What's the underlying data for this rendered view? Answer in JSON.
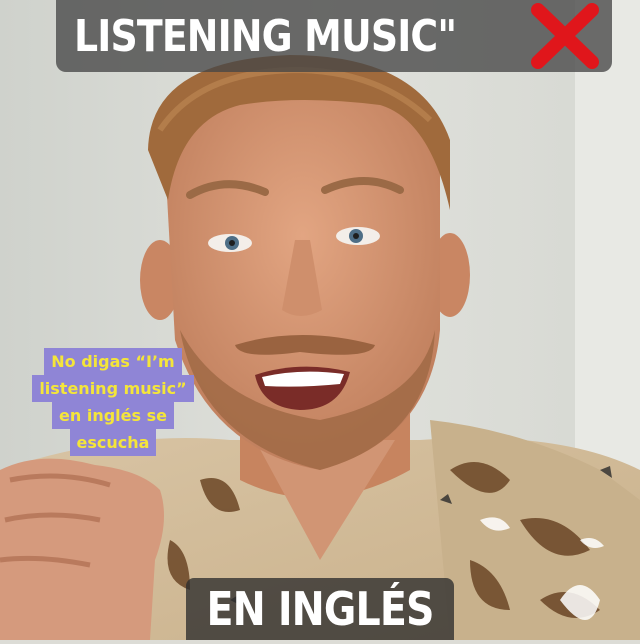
{
  "top_caption": {
    "text": "LISTENING MUSIC\"",
    "icon": "red-x-icon",
    "icon_color": "#e0161b"
  },
  "side_caption": {
    "lines": [
      "No digas “I’m",
      "listening music”",
      "en inglés se",
      "escucha"
    ],
    "text_color": "#f4e53a",
    "highlight_color": "#8f85d6"
  },
  "bottom_caption": {
    "text": "EN INGLÉS"
  }
}
